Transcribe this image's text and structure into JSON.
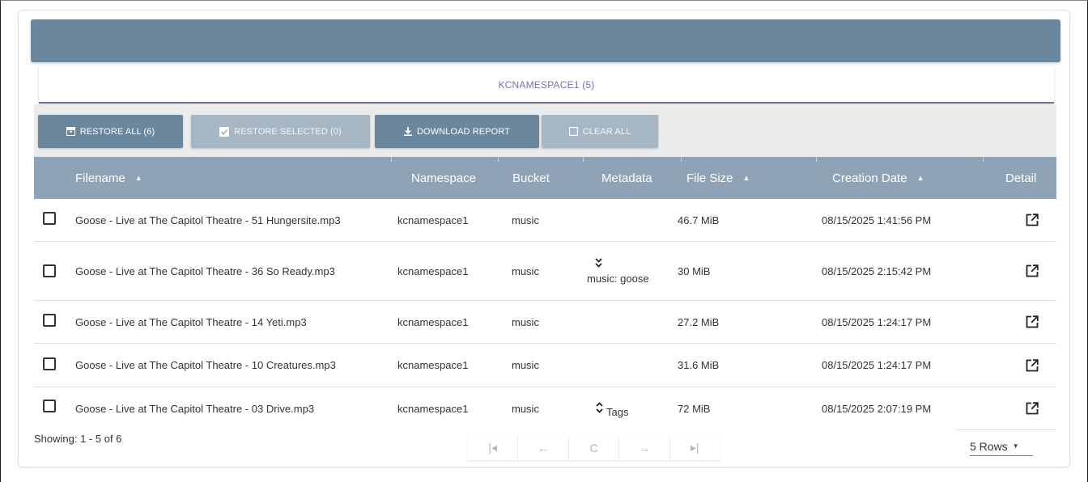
{
  "tab": {
    "label": "KCNAMESPACE1 (5)"
  },
  "toolbar": {
    "restore_all": "RESTORE ALL (6)",
    "restore_selected": "RESTORE SELECTED (0)",
    "download_report": "DOWNLOAD REPORT",
    "clear_all": "CLEAR ALL"
  },
  "table": {
    "columns": {
      "filename": "Filename",
      "namespace": "Namespace",
      "bucket": "Bucket",
      "metadata": "Metadata",
      "file_size": "File Size",
      "creation_date": "Creation Date",
      "detail": "Detail"
    },
    "rows": [
      {
        "filename": "Goose - Live at The Capitol Theatre - 51 Hungersite.mp3",
        "namespace": "kcnamespace1",
        "bucket": "music",
        "metadata": "",
        "size": "46.7 MiB",
        "date": "08/15/2025 1:41:56 PM"
      },
      {
        "filename": "Goose - Live at The Capitol Theatre - 36 So Ready.mp3",
        "namespace": "kcnamespace1",
        "bucket": "music",
        "metadata": "music: goose",
        "size": "30 MiB",
        "date": "08/15/2025 2:15:42 PM"
      },
      {
        "filename": "Goose - Live at The Capitol Theatre - 14 Yeti.mp3",
        "namespace": "kcnamespace1",
        "bucket": "music",
        "metadata": "",
        "size": "27.2 MiB",
        "date": "08/15/2025 1:24:17 PM"
      },
      {
        "filename": "Goose - Live at The Capitol Theatre - 10 Creatures.mp3",
        "namespace": "kcnamespace1",
        "bucket": "music",
        "metadata": "",
        "size": "31.6 MiB",
        "date": "08/15/2025 1:24:17 PM"
      },
      {
        "filename": "Goose - Live at The Capitol Theatre - 03 Drive.mp3",
        "namespace": "kcnamespace1",
        "bucket": "music",
        "metadata": "Tags",
        "size": "72 MiB",
        "date": "08/15/2025 2:07:19 PM"
      }
    ]
  },
  "footer": {
    "showing": "Showing: 1 - 5 of 6",
    "rows_per_page": "5 Rows"
  },
  "pager": {
    "first": "|◂",
    "prev": "←",
    "refresh": "C",
    "next": "→",
    "last": "▸|"
  },
  "colors": {
    "header_bar": "#6b879e",
    "table_header": "#8ea4b6",
    "tab_text": "#7b6fb0"
  }
}
